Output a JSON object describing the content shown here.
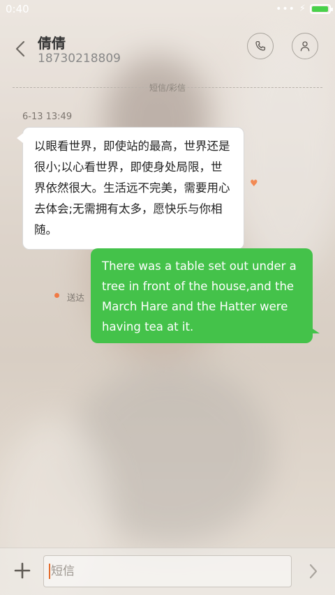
{
  "status_bar": {
    "time": "0:40",
    "icons": [
      "more-dots-icon",
      "charging-bolt-icon",
      "battery-icon"
    ],
    "battery_level": 0.9,
    "battery_color": "#48d14a"
  },
  "header": {
    "contact_name": "倩倩",
    "contact_number": "18730218809",
    "back_icon": "chevron-left-icon",
    "call_icon": "phone-icon",
    "profile_icon": "person-icon"
  },
  "conversation": {
    "divider_label": "短信/彩信",
    "timestamp": "6-13 13:49",
    "incoming_message": "以眼看世界，即使站的最高，世界还是很小;以心看世界，即使身处局限，世界依然很大。生活远不完美，需要用心去体会;无需拥有太多，愿快乐与你相随。",
    "outgoing_message": "There was a table set out under a tree in front of the house,and the March Hare and the Hatter were having tea at it.",
    "outgoing_status": "送达",
    "outgoing_bubble_color": "#44c24a",
    "heart_icon": "heart-icon",
    "status_color": "#f07a45"
  },
  "composer": {
    "placeholder": "短信",
    "value": "",
    "add_icon": "plus-icon",
    "send_icon": "chevron-right-icon"
  }
}
